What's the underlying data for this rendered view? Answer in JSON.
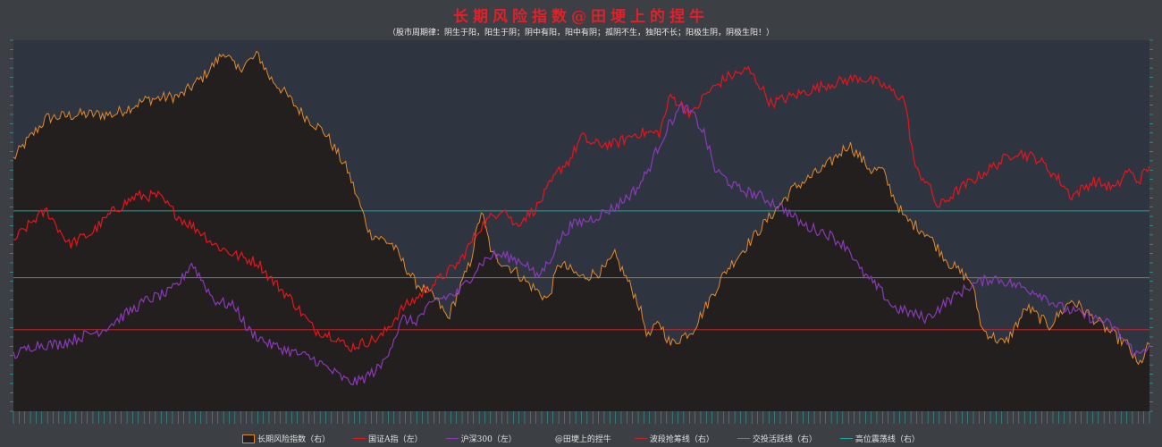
{
  "title": "长期风险指数@田埂上的捏牛",
  "subtitle": "（股市周期律：阴生于阳，阳生于阴；阴中有阳，阳中有阴；孤阴不生，独阳不长；阳极生阴，阴极生阳！）",
  "chart_data": {
    "type": "line",
    "x_count": 200,
    "ylim_left": [
      0,
      100
    ],
    "ylim_right": [
      0,
      100
    ],
    "grid": false,
    "legend_position": "bottom",
    "background": "#2e3540",
    "series": [
      {
        "name": "长期风险指数（右）",
        "kind": "area",
        "axis": "right",
        "color": "#e08a2a",
        "fill": "#231f1f",
        "keypoints": [
          [
            0,
            68
          ],
          [
            2,
            72
          ],
          [
            6,
            79
          ],
          [
            12,
            80
          ],
          [
            18,
            80
          ],
          [
            24,
            84
          ],
          [
            30,
            85
          ],
          [
            34,
            90
          ],
          [
            38,
            97
          ],
          [
            40,
            92
          ],
          [
            44,
            96
          ],
          [
            46,
            90
          ],
          [
            48,
            87
          ],
          [
            52,
            80
          ],
          [
            56,
            75
          ],
          [
            60,
            65
          ],
          [
            64,
            48
          ],
          [
            68,
            45
          ],
          [
            72,
            35
          ],
          [
            76,
            30
          ],
          [
            78,
            25
          ],
          [
            82,
            40
          ],
          [
            84,
            54
          ],
          [
            86,
            42
          ],
          [
            90,
            38
          ],
          [
            92,
            35
          ],
          [
            96,
            30
          ],
          [
            98,
            40
          ],
          [
            102,
            36
          ],
          [
            106,
            38
          ],
          [
            108,
            42
          ],
          [
            112,
            30
          ],
          [
            114,
            20
          ],
          [
            116,
            24
          ],
          [
            118,
            18
          ],
          [
            122,
            22
          ],
          [
            128,
            38
          ],
          [
            134,
            49
          ],
          [
            140,
            60
          ],
          [
            146,
            66
          ],
          [
            150,
            72
          ],
          [
            154,
            65
          ],
          [
            156,
            65
          ],
          [
            158,
            58
          ],
          [
            160,
            52
          ],
          [
            164,
            48
          ],
          [
            168,
            40
          ],
          [
            172,
            35
          ],
          [
            174,
            22
          ],
          [
            178,
            18
          ],
          [
            182,
            28
          ],
          [
            186,
            23
          ],
          [
            190,
            30
          ],
          [
            194,
            25
          ],
          [
            198,
            20
          ],
          [
            200,
            18
          ],
          [
            202,
            12
          ],
          [
            204,
            18
          ]
        ]
      },
      {
        "name": "国证A指（左）",
        "kind": "line",
        "axis": "left",
        "color": "#e8141c",
        "keypoints": [
          [
            0,
            46
          ],
          [
            4,
            52
          ],
          [
            6,
            54
          ],
          [
            10,
            45
          ],
          [
            14,
            48
          ],
          [
            18,
            54
          ],
          [
            22,
            58
          ],
          [
            26,
            58
          ],
          [
            30,
            52
          ],
          [
            34,
            48
          ],
          [
            36,
            45
          ],
          [
            40,
            42
          ],
          [
            44,
            40
          ],
          [
            46,
            36
          ],
          [
            50,
            30
          ],
          [
            54,
            22
          ],
          [
            58,
            20
          ],
          [
            60,
            17
          ],
          [
            62,
            18
          ],
          [
            66,
            20
          ],
          [
            70,
            28
          ],
          [
            72,
            30
          ],
          [
            76,
            35
          ],
          [
            80,
            40
          ],
          [
            84,
            50
          ],
          [
            88,
            55
          ],
          [
            90,
            50
          ],
          [
            94,
            55
          ],
          [
            98,
            65
          ],
          [
            100,
            68
          ],
          [
            102,
            74
          ],
          [
            104,
            72
          ],
          [
            108,
            72
          ],
          [
            112,
            75
          ],
          [
            116,
            75
          ],
          [
            118,
            85
          ],
          [
            122,
            80
          ],
          [
            124,
            85
          ],
          [
            128,
            90
          ],
          [
            132,
            92
          ],
          [
            134,
            88
          ],
          [
            136,
            83
          ],
          [
            140,
            85
          ],
          [
            146,
            88
          ],
          [
            152,
            90
          ],
          [
            156,
            88
          ],
          [
            160,
            84
          ],
          [
            162,
            65
          ],
          [
            164,
            62
          ],
          [
            166,
            55
          ],
          [
            170,
            60
          ],
          [
            172,
            62
          ],
          [
            176,
            66
          ],
          [
            180,
            70
          ],
          [
            184,
            68
          ],
          [
            188,
            62
          ],
          [
            190,
            58
          ],
          [
            194,
            62
          ],
          [
            198,
            60
          ],
          [
            200,
            65
          ],
          [
            202,
            62
          ],
          [
            204,
            66
          ]
        ]
      },
      {
        "name": "沪深300（左）",
        "kind": "line",
        "axis": "left",
        "color": "#8a3ab8",
        "keypoints": [
          [
            0,
            15
          ],
          [
            4,
            18
          ],
          [
            8,
            18
          ],
          [
            12,
            20
          ],
          [
            16,
            22
          ],
          [
            20,
            26
          ],
          [
            24,
            30
          ],
          [
            28,
            32
          ],
          [
            30,
            35
          ],
          [
            32,
            40
          ],
          [
            34,
            35
          ],
          [
            36,
            30
          ],
          [
            40,
            28
          ],
          [
            42,
            22
          ],
          [
            46,
            18
          ],
          [
            50,
            16
          ],
          [
            54,
            14
          ],
          [
            56,
            12
          ],
          [
            58,
            10
          ],
          [
            60,
            8
          ],
          [
            62,
            8
          ],
          [
            66,
            12
          ],
          [
            70,
            25
          ],
          [
            72,
            24
          ],
          [
            76,
            30
          ],
          [
            80,
            32
          ],
          [
            84,
            40
          ],
          [
            86,
            42
          ],
          [
            88,
            42
          ],
          [
            92,
            40
          ],
          [
            94,
            36
          ],
          [
            96,
            40
          ],
          [
            98,
            46
          ],
          [
            100,
            50
          ],
          [
            104,
            52
          ],
          [
            108,
            55
          ],
          [
            112,
            60
          ],
          [
            114,
            65
          ],
          [
            116,
            72
          ],
          [
            118,
            78
          ],
          [
            120,
            82
          ],
          [
            122,
            80
          ],
          [
            124,
            75
          ],
          [
            126,
            65
          ],
          [
            130,
            60
          ],
          [
            134,
            58
          ],
          [
            138,
            55
          ],
          [
            142,
            50
          ],
          [
            146,
            48
          ],
          [
            150,
            44
          ],
          [
            152,
            38
          ],
          [
            156,
            32
          ],
          [
            158,
            28
          ],
          [
            162,
            26
          ],
          [
            164,
            25
          ],
          [
            168,
            30
          ],
          [
            172,
            34
          ],
          [
            176,
            36
          ],
          [
            180,
            34
          ],
          [
            184,
            32
          ],
          [
            188,
            28
          ],
          [
            192,
            26
          ],
          [
            196,
            24
          ],
          [
            198,
            22
          ],
          [
            200,
            18
          ],
          [
            202,
            15
          ],
          [
            204,
            18
          ]
        ]
      },
      {
        "name": "@田埂上的捏牛",
        "kind": "legend-only",
        "color": "#3c3f44"
      },
      {
        "name": "波段抢筹线（右）",
        "kind": "hline",
        "axis": "right",
        "value": 22,
        "color": "#c0262a"
      },
      {
        "name": "交投活跃线（右）",
        "kind": "hline",
        "axis": "right",
        "value": 36,
        "color": "#7a7a7a"
      },
      {
        "name": "高位震荡线（右）",
        "kind": "hline",
        "axis": "right",
        "value": 54,
        "color": "#1aa89a"
      }
    ]
  }
}
